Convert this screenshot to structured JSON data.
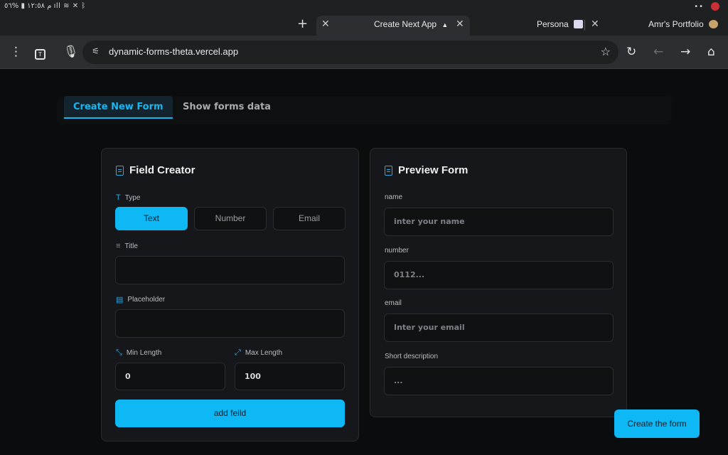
{
  "status_bar": {
    "time": "م ١٢:٥٨",
    "battery": "%٥٦"
  },
  "browser": {
    "tabs": [
      {
        "title": "Create Next App"
      },
      {
        "title": "Persona"
      },
      {
        "title": "Amr's Portfolio"
      }
    ],
    "url": "dynamic-forms-theta.vercel.app"
  },
  "page": {
    "tabs": {
      "create": "Create New Form",
      "show": "Show forms data"
    },
    "field_creator": {
      "title": "Field Creator",
      "type_label": "Type",
      "types": [
        "Text",
        "Number",
        "Email"
      ],
      "title_label": "Title",
      "title_value": "",
      "placeholder_label": "Placeholder",
      "placeholder_value": "",
      "min_label": "Min Length",
      "min_value": "0",
      "max_label": "Max Length",
      "max_value": "100",
      "add_button": "add feild"
    },
    "preview": {
      "title": "Preview Form",
      "fields": [
        {
          "label": "name",
          "placeholder": "inter your name"
        },
        {
          "label": "number",
          "placeholder": "0112..."
        },
        {
          "label": "email",
          "placeholder": "Inter your email"
        },
        {
          "label": "Short description",
          "placeholder": "..."
        }
      ]
    },
    "create_button": "Create the form"
  }
}
